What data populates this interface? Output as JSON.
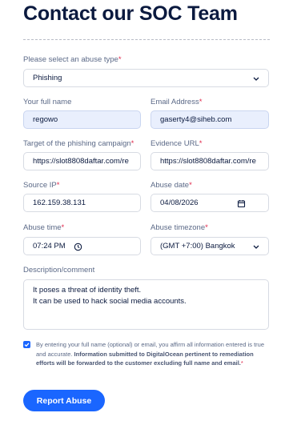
{
  "heading": "Contact our SOC Team",
  "abuse_type": {
    "label": "Please select an abuse type",
    "value": "Phishing"
  },
  "full_name": {
    "label": "Your full name",
    "value": "regowo"
  },
  "email": {
    "label": "Email Address",
    "value": "gaserty4@siheb.com"
  },
  "target": {
    "label": "Target of the phishing campaign",
    "value": "https://slot8808daftar.com/re"
  },
  "evidence": {
    "label": "Evidence URL",
    "value": "https://slot8808daftar.com/re"
  },
  "source_ip": {
    "label": "Source IP",
    "value": "162.159.38.131"
  },
  "abuse_date": {
    "label": "Abuse date",
    "value": "04/08/2026"
  },
  "abuse_time": {
    "label": "Abuse time",
    "value": "07:24 PM"
  },
  "timezone": {
    "label": "Abuse timezone",
    "value": "(GMT +7:00) Bangkok"
  },
  "description": {
    "label": "Description/comment",
    "line1": "It poses a threat of identity theft.",
    "line2": "It can be used to hack social media accounts."
  },
  "consent": {
    "checked": true,
    "text_plain": "By entering your full name (optional) or email, you affirm all information entered is true and accurate. ",
    "text_bold": "Information submitted to DigitalOcean pertinent to remediation efforts will be forwarded to the customer excluding full name and email."
  },
  "submit_label": "Report Abuse",
  "required_marker": "*",
  "colors": {
    "accent": "#1a66ff",
    "required": "#e0284b",
    "filled_bg": "#e9effd"
  }
}
